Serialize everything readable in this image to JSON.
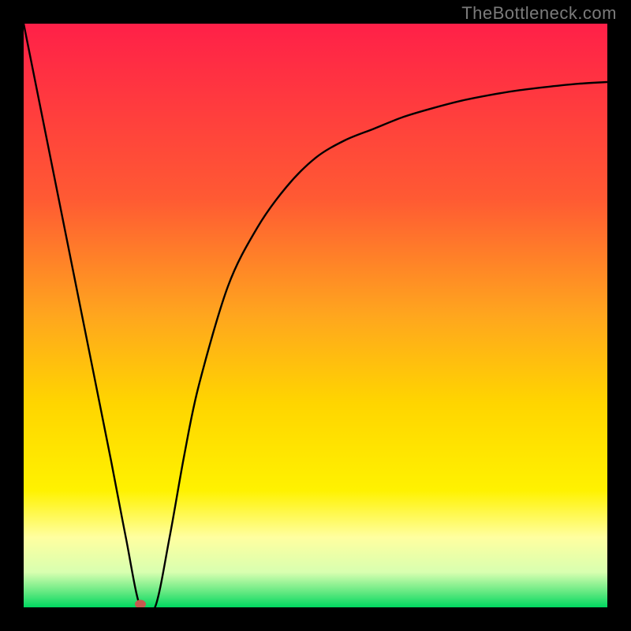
{
  "source_label": "TheBottleneck.com",
  "colors": {
    "frame": "#000000",
    "label": "#7b7b7b",
    "curve": "#000000",
    "marker": "#c6594f",
    "gradient_stops": [
      {
        "offset": 0.0,
        "color": "#ff2048"
      },
      {
        "offset": 0.3,
        "color": "#ff5a33"
      },
      {
        "offset": 0.5,
        "color": "#ffa61e"
      },
      {
        "offset": 0.65,
        "color": "#ffd500"
      },
      {
        "offset": 0.8,
        "color": "#fff200"
      },
      {
        "offset": 0.88,
        "color": "#ffffa0"
      },
      {
        "offset": 0.94,
        "color": "#d8ffb0"
      },
      {
        "offset": 0.975,
        "color": "#60e880"
      },
      {
        "offset": 1.0,
        "color": "#00d860"
      }
    ]
  },
  "chart_data": {
    "type": "line",
    "title": "",
    "xlabel": "",
    "ylabel": "",
    "xlim": [
      0,
      100
    ],
    "ylim": [
      0,
      100
    ],
    "grid": false,
    "legend": false,
    "marker": {
      "x": 20,
      "y": 0,
      "radius": 6
    },
    "series": [
      {
        "name": "bottleneck-curve",
        "x": [
          0,
          5,
          10,
          15,
          17.5,
          20,
          22.5,
          25,
          27.5,
          30,
          35,
          40,
          45,
          50,
          55,
          60,
          65,
          70,
          75,
          80,
          85,
          90,
          95,
          100
        ],
        "values": [
          100,
          75,
          50,
          25,
          12,
          0,
          0,
          12,
          26,
          38,
          55,
          65,
          72,
          77,
          80,
          82,
          84,
          85.5,
          86.8,
          87.8,
          88.6,
          89.2,
          89.7,
          90
        ]
      }
    ]
  }
}
